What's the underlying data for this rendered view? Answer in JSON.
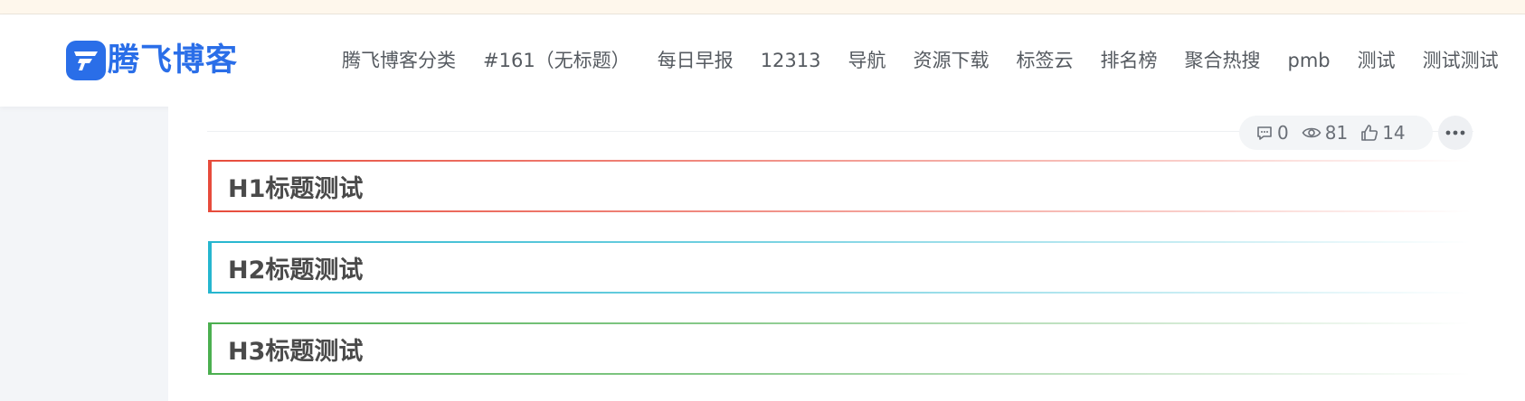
{
  "site": {
    "logo_text": "腾飞博客",
    "logo_icon": "tf-logo-icon",
    "brand_color": "#2a6ee8"
  },
  "nav": {
    "items": [
      "腾飞博客分类",
      "#161（无标题）",
      "每日早报",
      "12313",
      "导航",
      "资源下载",
      "标签云",
      "排名榜",
      "聚合热搜",
      "pmb",
      "测试",
      "测试测试"
    ]
  },
  "post_meta": {
    "comments": "0",
    "views": "81",
    "likes": "14",
    "comment_icon": "comment-icon",
    "view_icon": "eye-icon",
    "like_icon": "thumbs-up-icon",
    "more_icon": "more-dots-icon"
  },
  "content": {
    "headings": [
      {
        "text": "H1标题测试",
        "color": "#e74c3c"
      },
      {
        "text": "H2标题测试",
        "color": "#26b6cf"
      },
      {
        "text": "H3标题测试",
        "color": "#4caf50"
      }
    ]
  }
}
